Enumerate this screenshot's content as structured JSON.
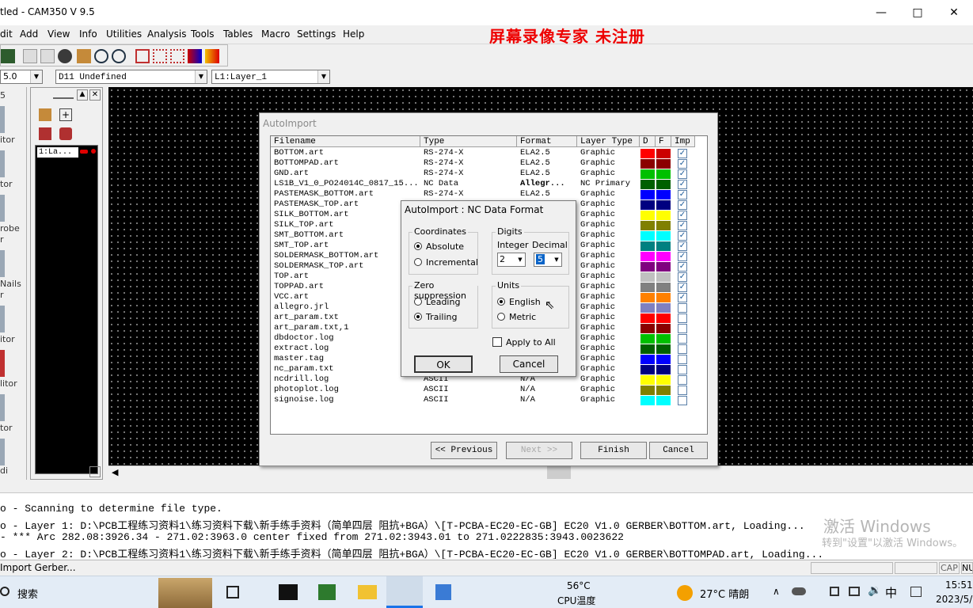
{
  "window": {
    "title": "tled - CAM350 V 9.5",
    "controls": [
      "—",
      "□",
      "✕"
    ]
  },
  "menu": [
    "dit",
    "Add",
    "View",
    "Info",
    "Utilities",
    "Analysis",
    "Tools",
    "Tables",
    "Macro",
    "Settings",
    "Help"
  ],
  "recorder_watermark": "屏幕录像专家  未注册",
  "combos": {
    "zoom": "5.0",
    "dcode": "D11    Undefined",
    "layer": "L1:Layer_1"
  },
  "left_strip_labels": [
    "5",
    "itor",
    "tor",
    "robe",
    "r",
    "Nails",
    "r",
    "itor",
    "litor",
    "tor",
    "di"
  ],
  "layer_panel": {
    "item": "1:La..."
  },
  "autoimport": {
    "title": "AutoImport",
    "columns": [
      "Filename",
      "Type",
      "Format",
      "Layer Type",
      "D",
      "F",
      "Imp"
    ],
    "rows": [
      {
        "file": "BOTTOM.art",
        "type": "RS-274-X",
        "format": "ELA2.5",
        "layer": "Graphic",
        "d": "#ff0000",
        "f": "#cc0000",
        "imp": true
      },
      {
        "file": "BOTTOMPAD.art",
        "type": "RS-274-X",
        "format": "ELA2.5",
        "layer": "Graphic",
        "d": "#8b0000",
        "f": "#8b0000",
        "imp": true
      },
      {
        "file": "GND.art",
        "type": "RS-274-X",
        "format": "ELA2.5",
        "layer": "Graphic",
        "d": "#00c000",
        "f": "#00c000",
        "imp": true
      },
      {
        "file": "LS1B_V1_0_PO24014C_0817_15...",
        "type": "NC Data",
        "format": "Allegr...",
        "layer": "NC Primary",
        "d": "#006000",
        "f": "#006000",
        "imp": true
      },
      {
        "file": "PASTEMASK_BOTTOM.art",
        "type": "RS-274-X",
        "format": "ELA2.5",
        "layer": "Graphic",
        "d": "#0000ff",
        "f": "#0000ff",
        "imp": true
      },
      {
        "file": "PASTEMASK_TOP.art",
        "type": "",
        "format": "",
        "layer": "Graphic",
        "d": "#000080",
        "f": "#000080",
        "imp": true
      },
      {
        "file": "SILK_BOTTOM.art",
        "type": "",
        "format": "",
        "layer": "Graphic",
        "d": "#ffff00",
        "f": "#ffff00",
        "imp": true
      },
      {
        "file": "SILK_TOP.art",
        "type": "",
        "format": "",
        "layer": "Graphic",
        "d": "#808000",
        "f": "#808000",
        "imp": true
      },
      {
        "file": "SMT_BOTTOM.art",
        "type": "",
        "format": "",
        "layer": "Graphic",
        "d": "#00ffff",
        "f": "#00ffff",
        "imp": true
      },
      {
        "file": "SMT_TOP.art",
        "type": "",
        "format": "",
        "layer": "Graphic",
        "d": "#008080",
        "f": "#008080",
        "imp": true
      },
      {
        "file": "SOLDERMASK_BOTTOM.art",
        "type": "",
        "format": "",
        "layer": "Graphic",
        "d": "#ff00ff",
        "f": "#ff00ff",
        "imp": true
      },
      {
        "file": "SOLDERMASK_TOP.art",
        "type": "",
        "format": "",
        "layer": "Graphic",
        "d": "#800080",
        "f": "#800080",
        "imp": true
      },
      {
        "file": "TOP.art",
        "type": "",
        "format": "",
        "layer": "Graphic",
        "d": "#c0c0c0",
        "f": "#c0c0c0",
        "imp": true
      },
      {
        "file": "TOPPAD.art",
        "type": "",
        "format": "",
        "layer": "Graphic",
        "d": "#808080",
        "f": "#808080",
        "imp": true
      },
      {
        "file": "VCC.art",
        "type": "",
        "format": "",
        "layer": "Graphic",
        "d": "#ff8000",
        "f": "#ff8000",
        "imp": true
      },
      {
        "file": "allegro.jrl",
        "type": "",
        "format": "",
        "layer": "Graphic",
        "d": "#8080c0",
        "f": "#8080c0",
        "imp": false
      },
      {
        "file": "art_param.txt",
        "type": "",
        "format": "",
        "layer": "Graphic",
        "d": "#ff0000",
        "f": "#ff0000",
        "imp": false
      },
      {
        "file": "art_param.txt,1",
        "type": "",
        "format": "",
        "layer": "Graphic",
        "d": "#8b0000",
        "f": "#8b0000",
        "imp": false
      },
      {
        "file": "dbdoctor.log",
        "type": "",
        "format": "",
        "layer": "Graphic",
        "d": "#00c000",
        "f": "#00c000",
        "imp": false
      },
      {
        "file": "extract.log",
        "type": "",
        "format": "",
        "layer": "Graphic",
        "d": "#006000",
        "f": "#006000",
        "imp": false
      },
      {
        "file": "master.tag",
        "type": "",
        "format": "",
        "layer": "Graphic",
        "d": "#0000ff",
        "f": "#0000ff",
        "imp": false
      },
      {
        "file": "nc_param.txt",
        "type": "",
        "format": "",
        "layer": "Graphic",
        "d": "#000080",
        "f": "#000080",
        "imp": false
      },
      {
        "file": "ncdrill.log",
        "type": "ASCII",
        "format": "N/A",
        "layer": "Graphic",
        "d": "#ffff00",
        "f": "#ffff00",
        "imp": false
      },
      {
        "file": "photoplot.log",
        "type": "ASCII",
        "format": "N/A",
        "layer": "Graphic",
        "d": "#808000",
        "f": "#808000",
        "imp": false
      },
      {
        "file": "signoise.log",
        "type": "ASCII",
        "format": "N/A",
        "layer": "Graphic",
        "d": "#00ffff",
        "f": "#00ffff",
        "imp": false
      }
    ],
    "buttons": {
      "previous": "<< Previous",
      "next": "Next >>",
      "finish": "Finish",
      "cancel": "Cancel"
    }
  },
  "nc_dialog": {
    "title": "AutoImport : NC Data Format",
    "coordinates": {
      "label": "Coordinates",
      "absolute": "Absolute",
      "incremental": "Incremental",
      "selected": "absolute"
    },
    "digits": {
      "label": "Digits",
      "integer_label": "Integer",
      "decimal_label": "Decimal",
      "integer": "2",
      "decimal": "5"
    },
    "zero": {
      "label": "Zero suppression",
      "leading": "Leading",
      "trailing": "Trailing",
      "selected": "trailing"
    },
    "units": {
      "label": "Units",
      "english": "English",
      "metric": "Metric",
      "selected": "english"
    },
    "apply_all": "Apply to All",
    "ok": "OK",
    "cancel": "Cancel"
  },
  "console": [
    "o - Scanning to determine file type.",
    "o - Layer 1: D:\\PCB工程练习资料1\\练习资料下载\\新手练手资料（简单四层 阻抗+BGA）\\[T-PCBA-EC20-EC-GB] EC20 V1.0 GERBER\\BOTTOM.art, Loading...",
    "- *** Arc 282.08:3926.34 - 271.02:3963.0 center fixed from 271.02:3943.01 to 271.0222835:3943.0023622",
    "o - Layer 2: D:\\PCB工程练习资料1\\练习资料下载\\新手练手资料（简单四层 阻抗+BGA）\\[T-PCBA-EC20-EC-GB] EC20 V1.0 GERBER\\BOTTOMPAD.art, Loading..."
  ],
  "activation_watermark": {
    "line1": "激活 Windows",
    "line2": "转到\"设置\"以激活 Windows。"
  },
  "status": {
    "text": "Import Gerber...",
    "cap": "CAP",
    "num": "NU"
  },
  "taskbar": {
    "search": "搜索",
    "temp": "56°C",
    "temp_label": "CPU温度",
    "weather": "27°C 晴朗",
    "ime": "中",
    "time": "15:51",
    "date": "2023/5/"
  }
}
